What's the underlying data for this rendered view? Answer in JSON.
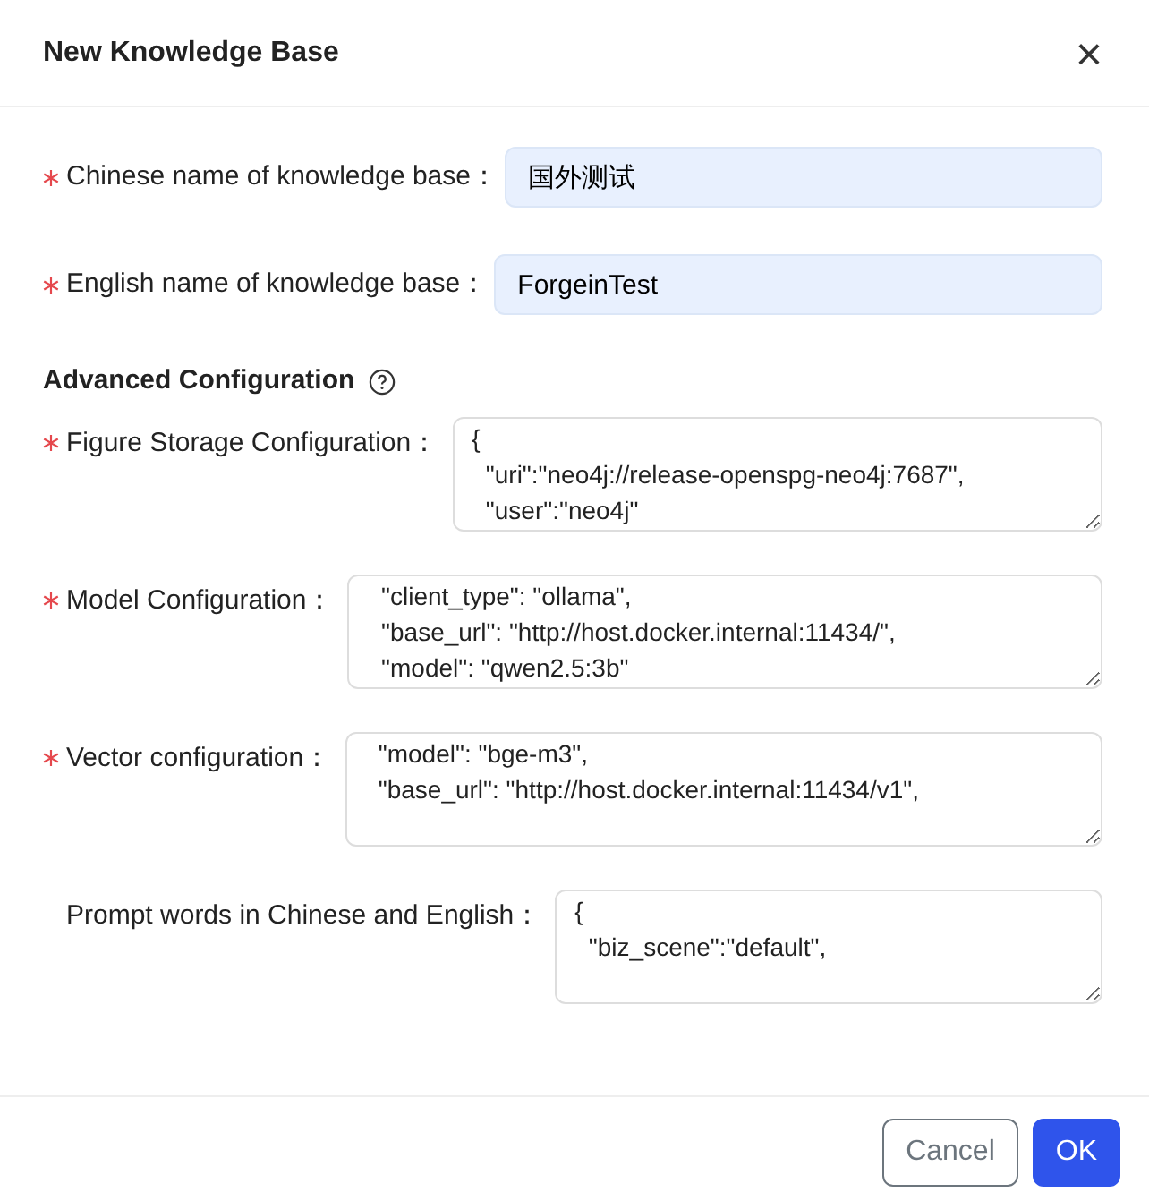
{
  "dialog": {
    "title": "New Knowledge Base",
    "close": "×"
  },
  "basic_fields": [
    {
      "label": "Chinese name of knowledge base：",
      "required": true,
      "value": "国外测试"
    },
    {
      "label": "English name of knowledge base：",
      "required": true,
      "value": "ForgeinTest"
    }
  ],
  "section": {
    "title": "Advanced Configuration"
  },
  "config_fields": [
    {
      "label": "Figure Storage Configuration：",
      "required": true,
      "lines": [
        "{",
        "  \"uri\":\"neo4j://release-openspg-neo4j:7687\",",
        "  \"user\":\"neo4j\""
      ]
    },
    {
      "label": "Model Configuration：",
      "required": true,
      "lines": [
        "  \"client_type\": \"ollama\",",
        "  \"base_url\": \"http://host.docker.internal:11434/\",",
        "  \"model\": \"qwen2.5:3b\""
      ]
    },
    {
      "label": "Vector configuration：",
      "required": true,
      "lines": [
        "  \"model\": \"bge-m3\",",
        "  \"base_url\": \"http://host.docker.internal:11434/v1\","
      ]
    },
    {
      "label": "Prompt words in Chinese and English：",
      "required": false,
      "lines": [
        "{",
        "  \"biz_scene\":\"default\","
      ]
    }
  ],
  "buttons": [
    {
      "label": "Cancel",
      "kind": "secondary"
    },
    {
      "label": "OK",
      "kind": "primary"
    }
  ]
}
